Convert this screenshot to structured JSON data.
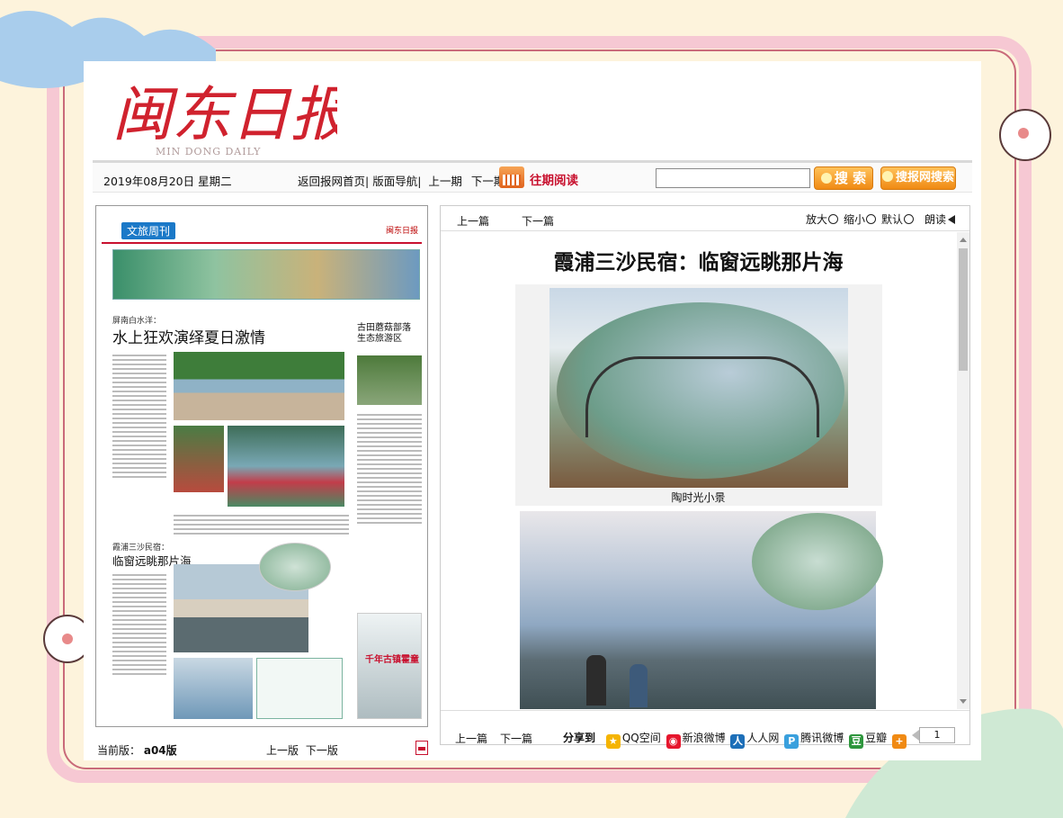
{
  "masthead": {
    "title": "闽东日报",
    "subtitle": "MIN DONG DAILY"
  },
  "toolbar": {
    "date": "2019年08月20日 星期二",
    "nav": [
      "返回报网首页|",
      "版面导航|",
      "上一期",
      "下一期|"
    ],
    "past_issues": "往期阅读",
    "search_value": "",
    "search_button": "搜 索",
    "site_search_button": "搜报网搜索"
  },
  "newspaper": {
    "section_tag": "文旅周刊",
    "kicker1": "屏南白水洋：",
    "headline1": "水上狂欢演绎夏日激情",
    "right_headline": "古田蘑菇部落 生态旅游区",
    "kicker2": "霞浦三沙民宿：",
    "headline2": "临窗远眺那片海",
    "ad_text": "千年古镇霍童"
  },
  "page_nav": {
    "current_label": "当前版：",
    "current_value": "a04版",
    "prev": "上一版",
    "next": "下一版"
  },
  "article": {
    "prev": "上一篇",
    "next": "下一篇",
    "zoom_in": "放大",
    "zoom_out": "缩小",
    "default": "默认",
    "read": "朗读",
    "title": "霞浦三沙民宿：临窗远眺那片海",
    "caption": "陶时光小景"
  },
  "share": {
    "label": "分享到",
    "items": [
      {
        "name": "QQ空间",
        "color": "#f5b400",
        "glyph": "★"
      },
      {
        "name": "新浪微博",
        "color": "#e6162d",
        "glyph": "◉"
      },
      {
        "name": "人人网",
        "color": "#1d6fb8",
        "glyph": "人"
      },
      {
        "name": "腾讯微博",
        "color": "#3aa0dd",
        "glyph": "P"
      },
      {
        "name": "豆瓣",
        "color": "#2e963d",
        "glyph": "豆"
      }
    ],
    "more_color": "#f08a14",
    "count": "1"
  }
}
